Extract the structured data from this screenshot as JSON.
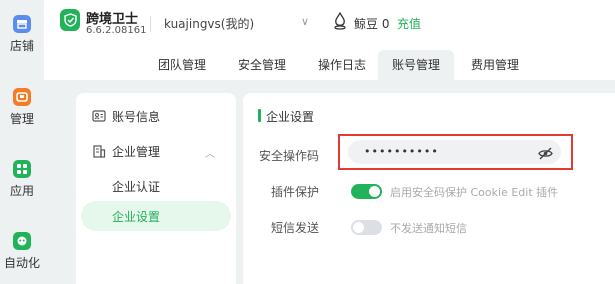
{
  "rail": [
    {
      "label": "店铺",
      "icon": "store-icon",
      "color": "#5b8def"
    },
    {
      "label": "管理",
      "icon": "manage-icon",
      "color": "#f57c26"
    },
    {
      "label": "应用",
      "icon": "apps-icon",
      "color": "#21b25a"
    },
    {
      "label": "自动化",
      "icon": "robot-icon",
      "color": "#21b25a"
    }
  ],
  "header": {
    "app_name": "跨境卫士",
    "version": "6.6.2.08161",
    "account": "kuajingvs(我的)",
    "beans": "鲸豆 0",
    "recharge": "充值",
    "tabs": [
      "团队管理",
      "安全管理",
      "操作日志",
      "账号管理",
      "费用管理"
    ],
    "active_tab": "账号管理"
  },
  "sidebar": {
    "account_info": "账号信息",
    "enterprise_mgmt": "企业管理",
    "enterprise_auth": "企业认证",
    "enterprise_settings": "企业设置"
  },
  "settings": {
    "title": "企业设置",
    "pwd_label": "安全操作码",
    "pwd_value": "••••••••••",
    "plugin_label": "插件保护",
    "plugin_enabled": true,
    "plugin_text": "启用安全码保护 Cookie Edit 插件",
    "sms_label": "短信发送",
    "sms_enabled": false,
    "sms_text": "不发送通知短信"
  },
  "colors": {
    "accent": "#21b25a",
    "highlight": "#e53935"
  }
}
